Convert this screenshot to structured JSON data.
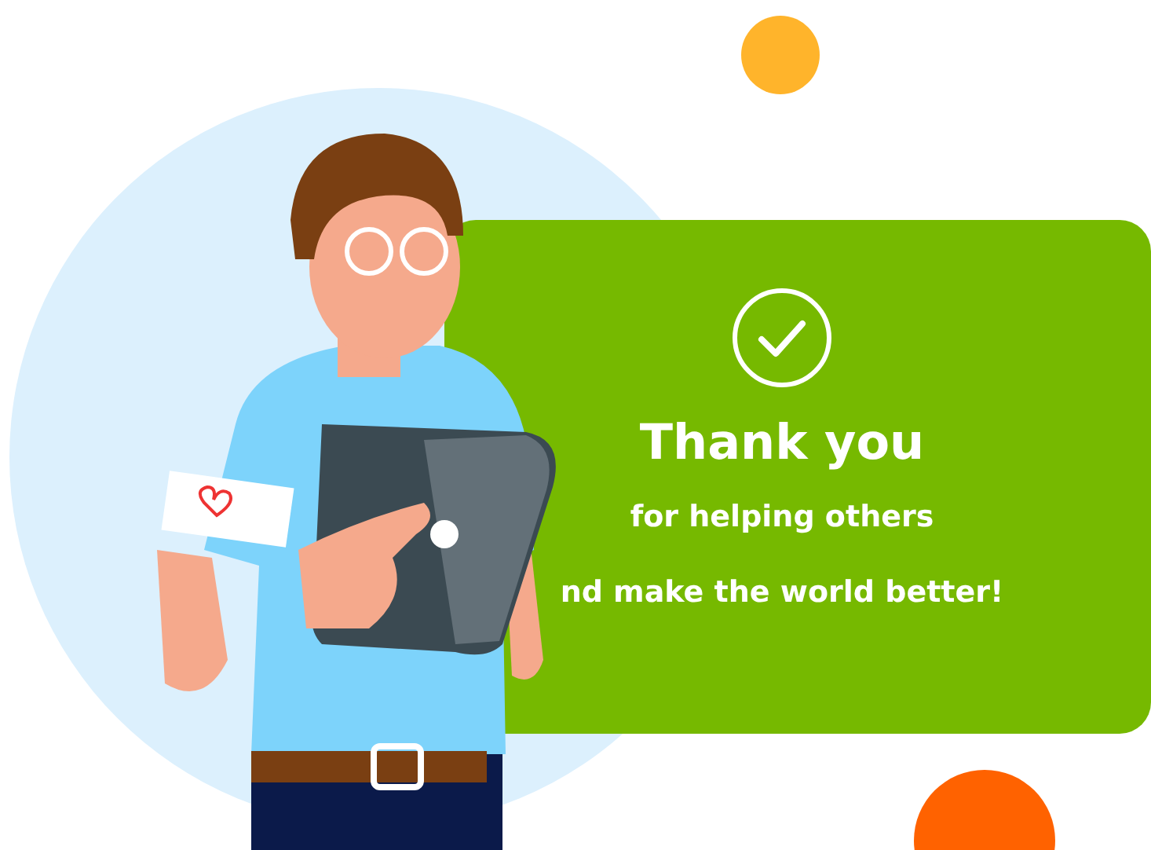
{
  "card": {
    "title": "Thank you",
    "lines": [
      "for helping others",
      "nd make the world better!"
    ]
  }
}
